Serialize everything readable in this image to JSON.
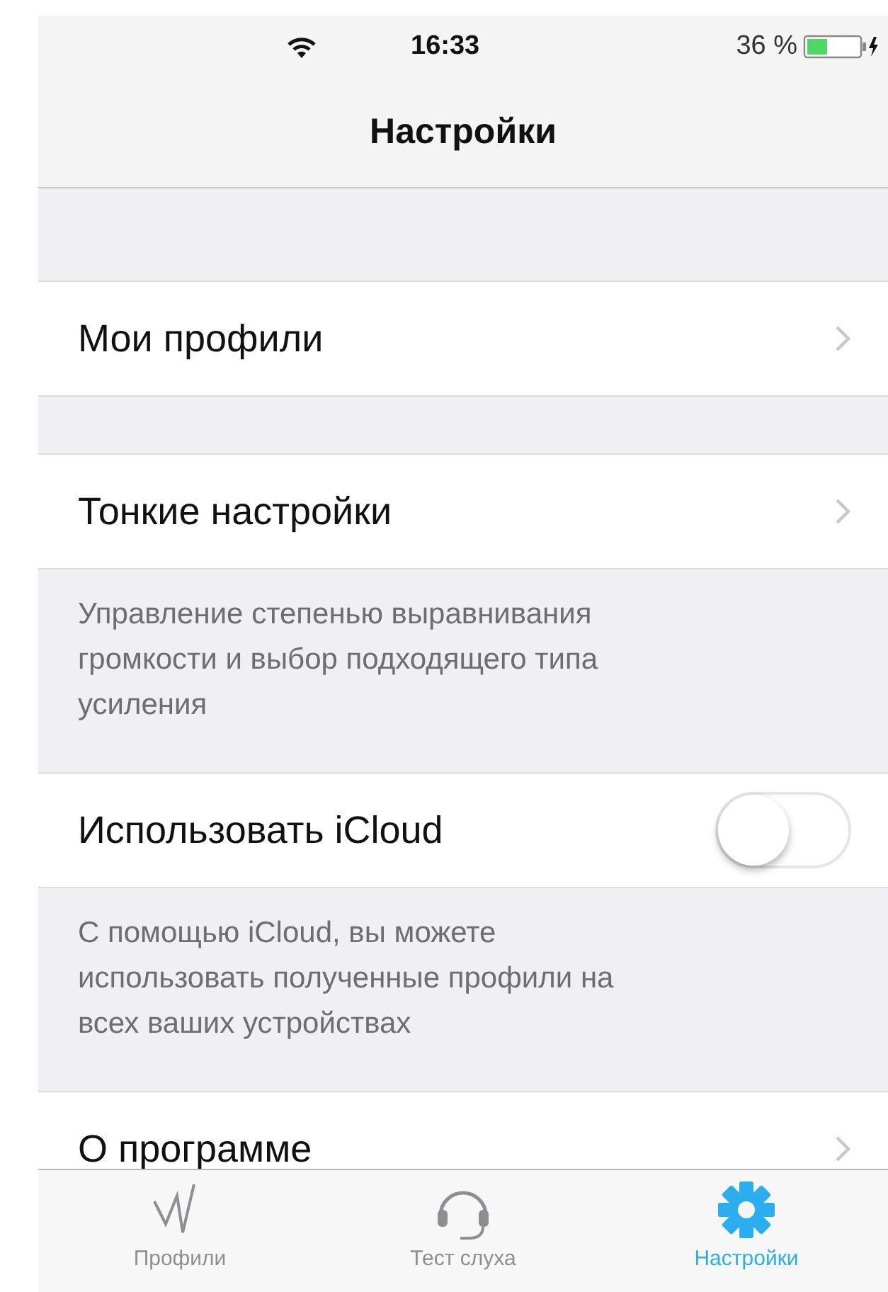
{
  "status_bar": {
    "time": "16:33",
    "battery": "36 %"
  },
  "nav": {
    "title": "Настройки"
  },
  "groups": [
    {
      "rows": [
        {
          "label": "Мои профили",
          "kind": "link"
        }
      ]
    },
    {
      "rows": [
        {
          "label": "Тонкие настройки",
          "kind": "link"
        }
      ],
      "footer": "Управление степенью выравнивания\nгромкости и выбор подходящего типа\nусиления"
    },
    {
      "rows": [
        {
          "label": "Использовать iCloud",
          "kind": "toggle",
          "on": false
        }
      ],
      "footer": "С помощью iCloud, вы можете\nиспользовать полученные профили на\nвсех ваших устройствах"
    },
    {
      "rows": [
        {
          "label": "О программе",
          "kind": "link"
        }
      ]
    }
  ],
  "tab_bar": [
    {
      "label": "Профили",
      "selected": false
    },
    {
      "label": "Тест слуха",
      "selected": false
    },
    {
      "label": "Настройки",
      "selected": true
    }
  ]
}
